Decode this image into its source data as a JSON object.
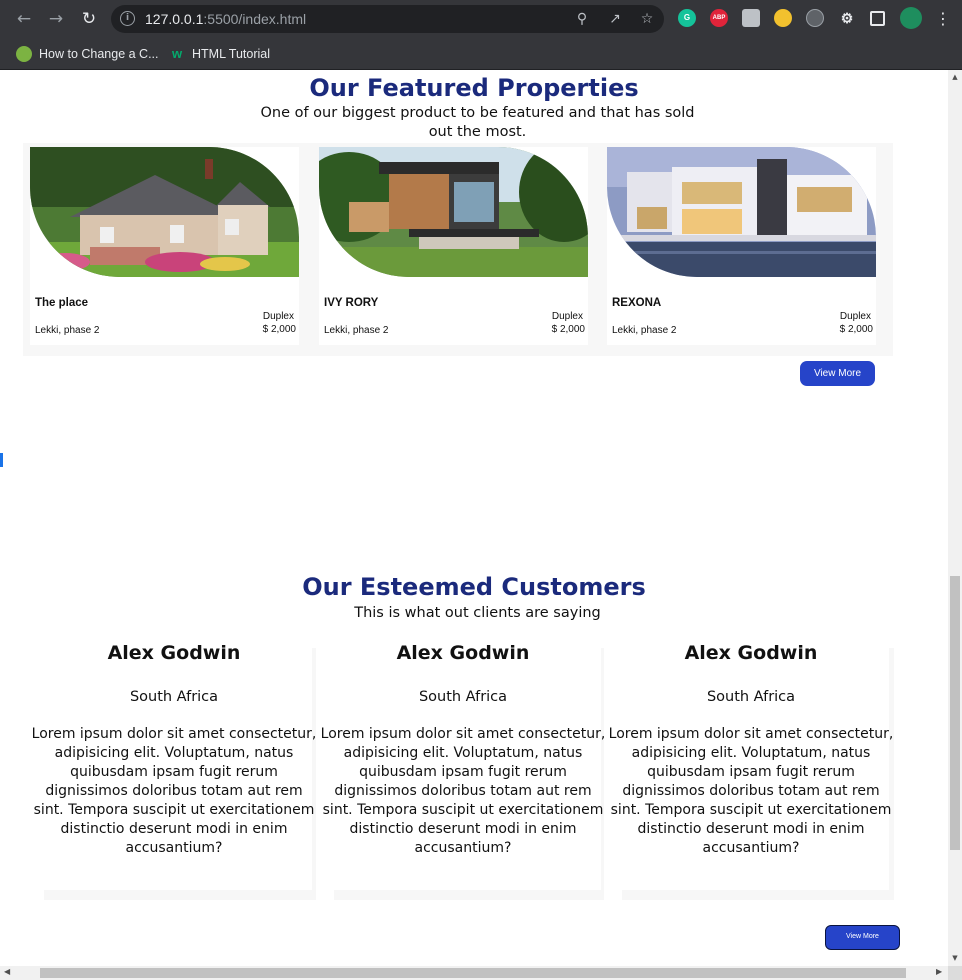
{
  "browser": {
    "url_host": "127.0.0.1",
    "url_path": ":5500/index.html",
    "bookmarks": [
      {
        "label": "How to Change a C..."
      },
      {
        "label": "HTML Tutorial"
      }
    ],
    "extensions": [
      "G",
      "ABP"
    ]
  },
  "featured": {
    "title": "Our Featured Properties",
    "subtitle": "One of our biggest product to be featured and that has sold out the most.",
    "properties": [
      {
        "name": "The place",
        "type": "Duplex",
        "location": "Lekki, phase 2",
        "price": "$ 2,000"
      },
      {
        "name": "IVY RORY",
        "type": "Duplex",
        "location": "Lekki, phase 2",
        "price": "$ 2,000"
      },
      {
        "name": "REXONA",
        "type": "Duplex",
        "location": "Lekki, phase 2",
        "price": "$ 2,000"
      }
    ],
    "view_more": "View More"
  },
  "customers": {
    "title": "Our Esteemed Customers",
    "subtitle": "This is what out clients are saying",
    "testimonials": [
      {
        "name": "Alex Godwin",
        "country": "South Africa",
        "text": "Lorem ipsum dolor sit amet consectetur, adipisicing elit. Voluptatum, natus quibusdam ipsam fugit rerum dignissimos doloribus totam aut rem sint. Tempora suscipit ut exercitationem distinctio deserunt modi in enim accusantium?"
      },
      {
        "name": "Alex Godwin",
        "country": "South Africa",
        "text": "Lorem ipsum dolor sit amet consectetur, adipisicing elit. Voluptatum, natus quibusdam ipsam fugit rerum dignissimos doloribus totam aut rem sint. Tempora suscipit ut exercitationem distinctio deserunt modi in enim accusantium?"
      },
      {
        "name": "Alex Godwin",
        "country": "South Africa",
        "text": "Lorem ipsum dolor sit amet consectetur, adipisicing elit. Voluptatum, natus quibusdam ipsam fugit rerum dignissimos doloribus totam aut rem sint. Tempora suscipit ut exercitationem distinctio deserunt modi in enim accusantium?"
      }
    ],
    "view_more": "View More"
  },
  "colors": {
    "heading": "#1b2a7c",
    "button": "#2644c9",
    "chrome": "#35363a"
  }
}
